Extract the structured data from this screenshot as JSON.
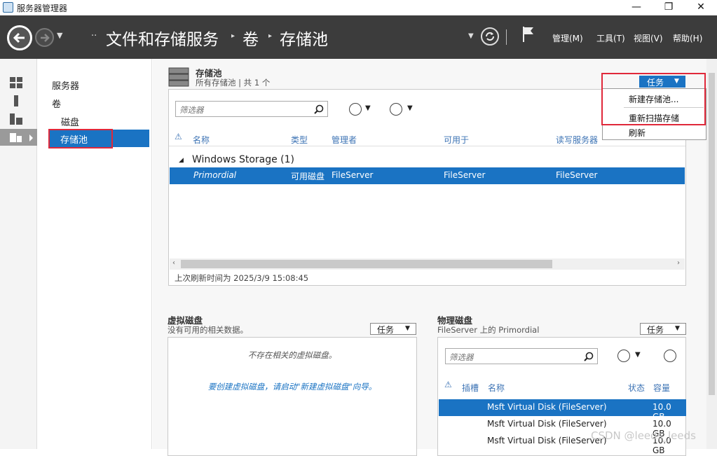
{
  "window": {
    "title": "服务器管理器",
    "minimize": "—",
    "maximize": "❐",
    "close": "✕"
  },
  "header": {
    "breadcrumb": [
      "文件和存储服务",
      "卷",
      "存储池"
    ],
    "breadcrumb_prefix": "··",
    "menus": [
      "管理(M)",
      "工具(T)",
      "视图(V)",
      "帮助(H)"
    ]
  },
  "subnav": {
    "items": [
      "服务器",
      "卷",
      "磁盘",
      "存储池"
    ],
    "selected": "存储池"
  },
  "pools": {
    "title": "存储池",
    "subtitle": "所有存储池 | 共 1 个",
    "filter_placeholder": "筛选器",
    "task_label": "任务",
    "columns": [
      "名称",
      "类型",
      "管理者",
      "可用于",
      "读写服务器"
    ],
    "group": "Windows Storage (1)",
    "rows": [
      {
        "name": "Primordial",
        "type": "可用磁盘",
        "manager": "FileServer",
        "available": "FileServer",
        "rw_server": "FileServer"
      }
    ],
    "last_refresh": "上次刷新时间为 2025/3/9 15:08:45"
  },
  "task_menu": {
    "items": [
      "新建存储池...",
      "重新扫描存储",
      "刷新"
    ]
  },
  "virtual_disks": {
    "title": "虚拟磁盘",
    "subtitle": "没有可用的相关数据。",
    "task_label": "任务",
    "empty_msg": "不存在相关的虚拟磁盘。",
    "hint": "要创建虚拟磁盘，请启动\"新建虚拟磁盘\"向导。"
  },
  "physical_disks": {
    "title": "物理磁盘",
    "subtitle": "FileServer 上的 Primordial",
    "task_label": "任务",
    "filter_placeholder": "筛选器",
    "columns": [
      "插槽",
      "名称",
      "状态",
      "容量"
    ],
    "rows": [
      {
        "name": "Msft Virtual Disk (FileServer)",
        "capacity": "10.0 GB"
      },
      {
        "name": "Msft Virtual Disk (FileServer)",
        "capacity": "10.0 GB"
      },
      {
        "name": "Msft Virtual Disk (FileServer)",
        "capacity": "10.0 GB"
      }
    ]
  },
  "watermark": "CSDN @leeds_leeds",
  "colors": {
    "accent": "#1a73c3",
    "highlight_box": "#e0283a",
    "header_bg": "#3c3c3c"
  }
}
